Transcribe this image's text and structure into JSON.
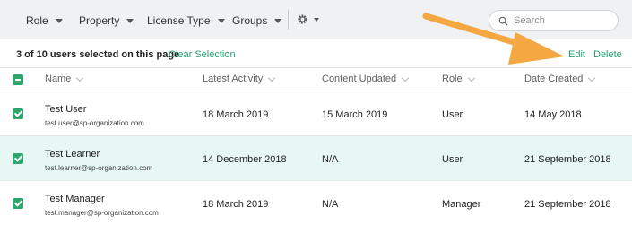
{
  "filters": {
    "role": "Role",
    "property": "Property",
    "license_type": "License Type",
    "groups": "Groups"
  },
  "search": {
    "placeholder": "Search"
  },
  "selection": {
    "count_text": "3 of 10 users selected on this page",
    "clear_label": "Clear Selection",
    "edit_label": "Edit",
    "delete_label": "Delete"
  },
  "columns": {
    "name": "Name",
    "latest_activity": "Latest Activity",
    "content_updated": "Content Updated",
    "role": "Role",
    "date_created": "Date Created"
  },
  "rows": [
    {
      "name": "Test User",
      "email": "test.user@sp-organization.com",
      "latest_activity": "18 March 2019",
      "content_updated": "15 March 2019",
      "role": "User",
      "date_created": "14 May 2018",
      "checked": true
    },
    {
      "name": "Test Learner",
      "email": "test.learner@sp-organization.com",
      "latest_activity": "14 December 2018",
      "content_updated": "N/A",
      "role": "User",
      "date_created": "21 September 2018",
      "checked": true
    },
    {
      "name": "Test Manager",
      "email": "test.manager@sp-organization.com",
      "latest_activity": "18 March 2019",
      "content_updated": "N/A",
      "role": "Manager",
      "date_created": "21 September 2018",
      "checked": true
    }
  ],
  "colors": {
    "accent": "#22a06b",
    "checkbox": "#2fa56d",
    "highlight_row": "#e7f7f3",
    "annotation_arrow": "#f5a742"
  },
  "icons": [
    "search-icon",
    "gear-icon",
    "caret-down-icon",
    "sort-chevron-icon",
    "checkbox-checked-icon",
    "checkbox-indeterminate-icon",
    "annotation-arrow"
  ]
}
